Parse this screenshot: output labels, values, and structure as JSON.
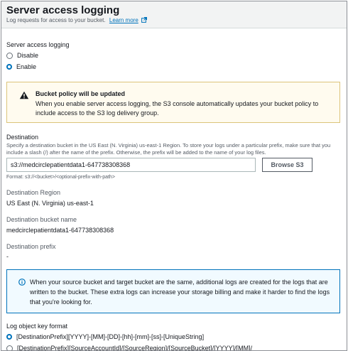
{
  "header": {
    "title": "Server access logging",
    "subtitle": "Log requests for access to your bucket.",
    "learn_more": "Learn more",
    "icon": "external-link-icon"
  },
  "logging": {
    "label": "Server access logging",
    "options": [
      "Disable",
      "Enable"
    ],
    "selected": "Enable"
  },
  "warning": {
    "icon": "warning-icon",
    "title": "Bucket policy will be updated",
    "text": "When you enable server access logging, the S3 console automatically updates your bucket policy to include access to the S3 log delivery group."
  },
  "destination": {
    "label": "Destination",
    "description": "Specify a destination bucket in the US East (N. Virginia) us-east-1 Region. To store your logs under a particular prefix, make sure that you include a slash (/) after the name of the prefix. Otherwise, the prefix will be added to the name of your log files.",
    "input_value": "s3://medcirclepatientdata1-647738308368",
    "browse_label": "Browse S3",
    "format_hint": "Format: s3://<bucket>/<optional-prefix-with-path>"
  },
  "region": {
    "label": "Destination Region",
    "value": "US East (N. Virginia) us-east-1"
  },
  "bucket": {
    "label": "Destination bucket name",
    "value": "medcirclepatientdata1-647738308368"
  },
  "prefix": {
    "label": "Destination prefix",
    "value": "-"
  },
  "info": {
    "icon": "info-icon",
    "text": "When your source bucket and target bucket are the same, additional logs are created for the logs that are written to the bucket. These extra logs can increase your storage billing and make it harder to find the logs that you're looking for."
  },
  "key_format": {
    "label": "Log object key format",
    "options": [
      "[DestinationPrefix][YYYY]-[MM]-[DD]-[hh]-[mm]-[ss]-[UniqueString]",
      "[DestinationPrefix][SourceAccountId]/[SourceRegion]/[SourceBucket]/[YYYY]/[MM]/"
    ],
    "selected_index": 0
  },
  "colors": {
    "accent": "#0073bb",
    "warning_bg": "#fffbef",
    "info_bg": "#f1faff"
  }
}
